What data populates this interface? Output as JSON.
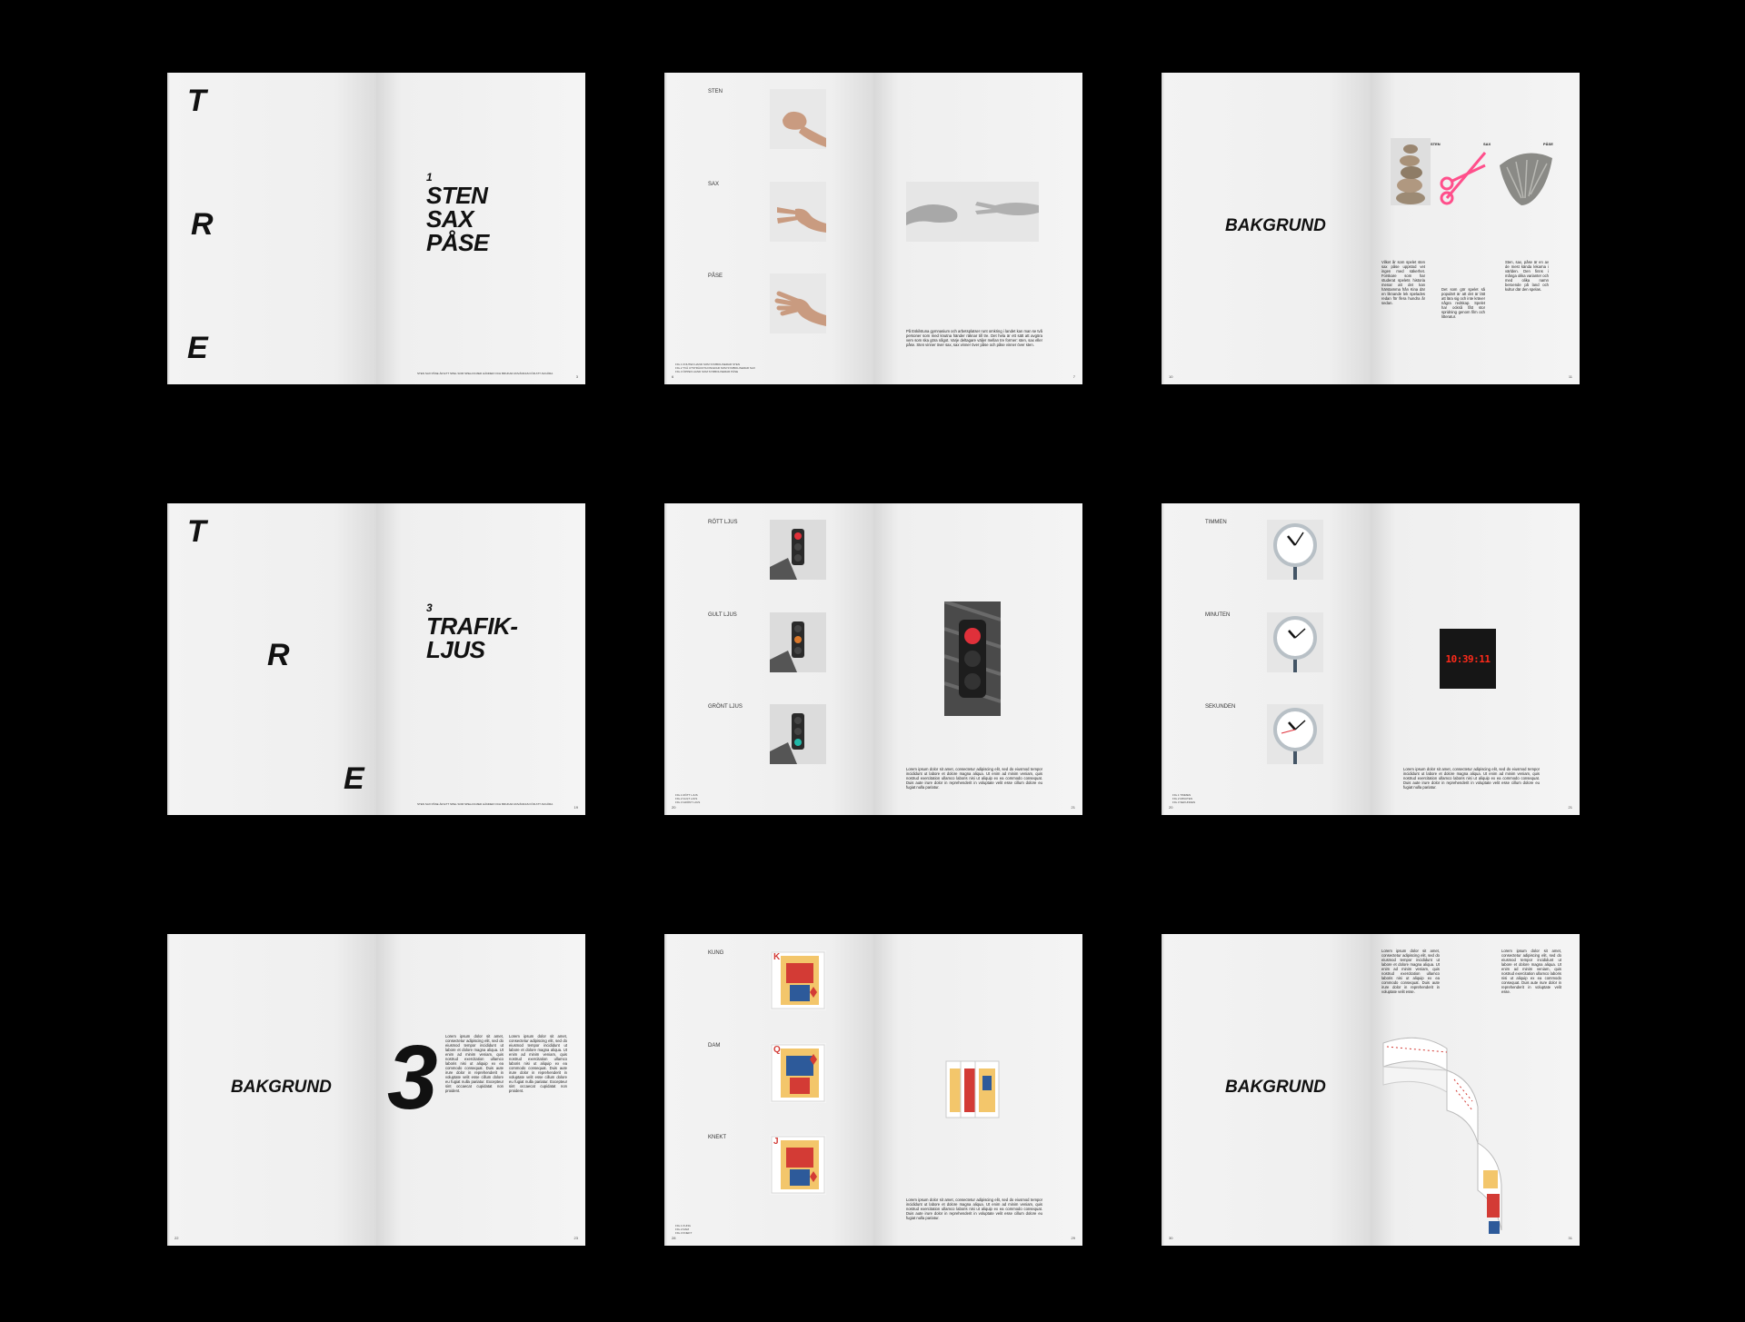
{
  "spreads": {
    "s1": {
      "letters": [
        "T",
        "R",
        "E"
      ],
      "chapter_num": "1",
      "chapter_lines": [
        "STEN",
        "SAX",
        "PÅSE"
      ],
      "footer": "STEN SAX PÅSE ÄR ETT SPEL SOM SPELAS MED HÄNDER OCH BRUKAR ANVÄNDAS FÖR ATT AVGÖRA",
      "page_left": "",
      "page_right": "3"
    },
    "s2": {
      "captions": [
        "STEN",
        "SAX",
        "PÅSE"
      ],
      "fig": "FIG.1",
      "fig_lines": [
        "FIG.1   KNUTEN HAND SOM SYMBOLISERAR STEN",
        "FIG.2   TVÅ UTSTRÄCKTA FINGRAR SOM SYMBOLISERAR SAX",
        "FIG.3   ÖPPEN HAND SOM SYMBOLISERAR PÅSE"
      ],
      "paragraph": "På Eskilstuna gymnasium och arbetsplatser runt omkring i landet kan man se två personer som med knutna händer räknar till tre. Det hela är ett sätt att avgöra vem som ska göra något. Varje deltagare väljer mellan tre former: sten, sax eller påse. Sten vinner över sax, sax vinner över påse och påse vinner över sten.",
      "page_left": "6",
      "page_right": "7"
    },
    "s3": {
      "title": "BAKGRUND",
      "labels": [
        "STEN",
        "SAX",
        "PÅSE"
      ],
      "col1": "Vilket år som spelet sten sax påse uppstod vet ingen med säkerhet. Forskare som har studerat spelets historia menar att det kan härstamma från Kina där en liknande lek spelades redan för flera hundra år sedan.",
      "col2": "Det som gör spelet så populärt är att det är lätt att lära sig och inte kräver några redskap. Spelet har också fått stor spridning genom film och litteratur.",
      "col3": "Sten, sax, påse är en av de mest kända lekarna i världen. Den finns i många olika varianter och med olika namn beroende på land och kultur där den spelas.",
      "page_left": "10",
      "page_right": "11"
    },
    "s4": {
      "letters": [
        "T",
        "R",
        "E"
      ],
      "chapter_num": "3",
      "chapter_lines": [
        "TRAFIK-",
        "LJUS"
      ],
      "footer": "STEN SAX PÅSE ÄR ETT SPEL SOM SPELAS MED HÄNDER OCH BRUKAR ANVÄNDAS FÖR ATT AVGÖRA",
      "page_left": "",
      "page_right": "19"
    },
    "s5": {
      "captions": [
        "RÖTT LJUS",
        "GULT LJUS",
        "GRÖNT LJUS"
      ],
      "fig_lines": [
        "FIG.1   RÖTT LJUS",
        "FIG.2   GULT LJUS",
        "FIG.3   GRÖNT LJUS"
      ],
      "paragraph": "Lorem ipsum dolor sit amet, consectetur adipiscing elit, sed do eiusmod tempor incididunt ut labore et dolore magna aliqua. Ut enim ad minim veniam, quis nostrud exercitation ullamco laboris nisi ut aliquip ex ea commodo consequat. Duis aute irure dolor in reprehenderit in voluptate velit esse cillum dolore eu fugiat nulla pariatur.",
      "page_left": "20",
      "page_right": "21"
    },
    "s6": {
      "captions": [
        "TIMMEN",
        "MINUTEN",
        "SEKUNDEN"
      ],
      "clock_time": "10:39:11",
      "fig_lines": [
        "FIG.1   TIMMEN",
        "FIG.2   MINUTEN",
        "FIG.3   SEKUNDEN"
      ],
      "paragraph": "Lorem ipsum dolor sit amet, consectetur adipiscing elit, sed do eiusmod tempor incididunt ut labore et dolore magna aliqua. Ut enim ad minim veniam, quis nostrud exercitation ullamco laboris nisi ut aliquip ex ea commodo consequat. Duis aute irure dolor in reprehenderit in voluptate velit esse cillum dolore eu fugiat nulla pariatur.",
      "page_left": "20",
      "page_right": "21"
    },
    "s7": {
      "title": "BAKGRUND",
      "big_number": "3",
      "col1": "Lorem ipsum dolor sit amet, consectetur adipiscing elit, sed do eiusmod tempor incididunt ut labore et dolore magna aliqua. Ut enim ad minim veniam, quis nostrud exercitation ullamco laboris nisi ut aliquip ex ea commodo consequat. Duis aute irure dolor in reprehenderit in voluptate velit esse cillum dolore eu fugiat nulla pariatur. Excepteur sint occaecat cupidatat non proident.",
      "col2": "Lorem ipsum dolor sit amet, consectetur adipiscing elit, sed do eiusmod tempor incididunt ut labore et dolore magna aliqua. Ut enim ad minim veniam, quis nostrud exercitation ullamco laboris nisi ut aliquip ex ea commodo consequat. Duis aute irure dolor in reprehenderit in voluptate velit esse cillum dolore eu fugiat nulla pariatur. Excepteur sint occaecat cupidatat non proident.",
      "page_left": "22",
      "page_right": "23"
    },
    "s8": {
      "captions": [
        "KUNG",
        "DAM",
        "KNEKT"
      ],
      "card_ranks": [
        "K",
        "Q",
        "J"
      ],
      "fig_lines": [
        "FIG.1   KUNG",
        "FIG.2   DAM",
        "FIG.3   KNEKT"
      ],
      "paragraph": "Lorem ipsum dolor sit amet, consectetur adipiscing elit, sed do eiusmod tempor incididunt ut labore et dolore magna aliqua. Ut enim ad minim veniam, quis nostrud exercitation ullamco laboris nisi ut aliquip ex ea commodo consequat. Duis aute irure dolor in reprehenderit in voluptate velit esse cillum dolore eu fugiat nulla pariatur.",
      "page_left": "28",
      "page_right": "29"
    },
    "s9": {
      "title": "BAKGRUND",
      "col1": "Lorem ipsum dolor sit amet, consectetur adipiscing elit, sed do eiusmod tempor incididunt ut labore et dolore magna aliqua. Ut enim ad minim veniam, quis nostrud exercitation ullamco laboris nisi ut aliquip ex ea commodo consequat. Duis aute irure dolor in reprehenderit in voluptate velit esse.",
      "col2": "Lorem ipsum dolor sit amet, consectetur adipiscing elit, sed do eiusmod tempor incididunt ut labore et dolore magna aliqua. Ut enim ad minim veniam, quis nostrud exercitation ullamco laboris nisi ut aliquip ex ea commodo consequat. Duis aute irure dolor in reprehenderit in voluptate velit esse.",
      "page_left": "30",
      "page_right": "31"
    }
  },
  "colors": {
    "background": "#000000",
    "paper": "#f1f1f1",
    "text": "#111111",
    "accent_red": "#e0303a",
    "accent_pink": "#ff4f8b",
    "digital_red": "#ff2a1a"
  },
  "icons": [
    "fist-hand-icon",
    "scissors-hand-icon",
    "open-hand-icon",
    "traffic-light-icon",
    "clock-icon",
    "digital-clock-icon",
    "playing-card-icon"
  ]
}
